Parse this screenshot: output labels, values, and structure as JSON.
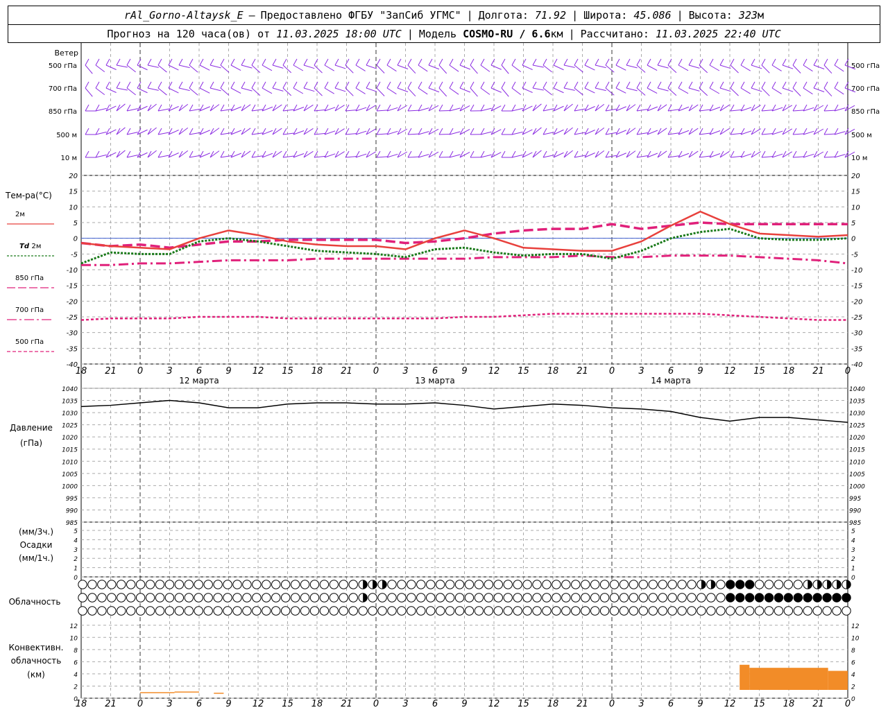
{
  "header": {
    "station": "rAl_Gorno-Altaysk_E",
    "dash": "–",
    "provider": "Предоставлено ФГБУ \"ЗапСиб УГМС\"",
    "lon_label": "Долгота:",
    "lon": "71.92",
    "lat_label": "Широта:",
    "lat": "45.086",
    "alt_label": "Высота:",
    "alt": "323",
    "alt_unit": "м",
    "forecast_prefix": "Прогноз на 120 часа(ов) от",
    "forecast_start": "11.03.2025 18:00 UTC",
    "model_label": "Модель",
    "model": "COSMO-RU / 6.6",
    "model_unit": "км",
    "calc_label": "Рассчитано:",
    "calc_time": "11.03.2025 22:40 UTC"
  },
  "time_axis": {
    "ticks": [
      "18",
      "21",
      "0",
      "3",
      "6",
      "9",
      "12",
      "15",
      "18",
      "21",
      "0",
      "3",
      "6",
      "9",
      "12",
      "15",
      "18",
      "21",
      "0",
      "3",
      "6",
      "9",
      "12",
      "15",
      "18",
      "21",
      "0"
    ],
    "day_labels": [
      "12 марта",
      "13 марта",
      "14 марта"
    ]
  },
  "wind_panel": {
    "title": "Ветер",
    "levels": [
      "500 гПа",
      "700 гПа",
      "850 гПа",
      "500 м",
      "10 м"
    ],
    "colors": {
      "barb": "#8a2be2"
    }
  },
  "temp_panel": {
    "title": "Тем-ра(°C)",
    "yticks": [
      "20",
      "15",
      "10",
      "5",
      "0",
      "-5",
      "-10",
      "-15",
      "-20",
      "-25",
      "-30",
      "-35",
      "-40"
    ],
    "legend": [
      {
        "prefix": "",
        "label": "2м",
        "color": "#e8403c",
        "style": "solid"
      },
      {
        "prefix": "Td",
        "label": "2м",
        "color": "#1a7a1a",
        "style": "dotted"
      },
      {
        "prefix": "",
        "label": "850 гПа",
        "color": "#e0207a",
        "style": "dash"
      },
      {
        "prefix": "",
        "label": "700 гПа",
        "color": "#e0207a",
        "style": "dashdot"
      },
      {
        "prefix": "",
        "label": "500 гПа",
        "color": "#e0207a",
        "style": "shortdash"
      }
    ]
  },
  "pressure_panel": {
    "title": "Давление",
    "unit": "(гПа)",
    "yticks": [
      "1040",
      "1035",
      "1030",
      "1025",
      "1020",
      "1015",
      "1010",
      "1005",
      "1000",
      "995",
      "990",
      "985"
    ]
  },
  "precip_panel": {
    "unit_top": "(мм/3ч.)",
    "title": "Осадки",
    "unit_bottom": "(мм/1ч.)",
    "yticks": [
      "5",
      "4",
      "3",
      "2",
      "1",
      "0"
    ]
  },
  "cloud_panel": {
    "title": "Облачность"
  },
  "conv_panel": {
    "title1": "Конвективн.",
    "title2": "облачность",
    "unit": "(км)",
    "yticks": [
      "12",
      "10",
      "8",
      "6",
      "4",
      "2",
      "0"
    ],
    "color": "#f28c28"
  },
  "chart_data": {
    "type": "line",
    "x_hours": [
      0,
      3,
      6,
      9,
      12,
      15,
      18,
      21,
      24,
      27,
      30,
      33,
      36,
      39,
      42,
      45,
      48,
      51,
      54,
      57,
      60,
      63,
      66,
      69,
      72,
      75,
      78
    ],
    "t2m": [
      -1.5,
      -2.5,
      -3,
      -3.5,
      0,
      2.5,
      1,
      -1,
      -2,
      -2.5,
      -2.5,
      -3.5,
      0,
      2.5,
      0,
      -3,
      -3.5,
      -4,
      -4,
      -1,
      4,
      8.5,
      4.5,
      1.5,
      1,
      0.5,
      1
    ],
    "td2m": [
      -8,
      -4.5,
      -5,
      -5,
      -1,
      0,
      -1,
      -2.5,
      -4,
      -4.5,
      -5,
      -6,
      -3.5,
      -3,
      -4.5,
      -5.5,
      -5,
      -5,
      -6.5,
      -4,
      0,
      2,
      3,
      0,
      -0.5,
      -0.5,
      0
    ],
    "t850": [
      -1.5,
      -2.5,
      -2,
      -3,
      -2,
      -1,
      -1,
      -0.5,
      -0.5,
      -0.5,
      -0.5,
      -1.5,
      -1,
      0,
      1.5,
      2.5,
      3,
      3,
      4.5,
      3,
      4,
      5,
      4.5,
      4.5,
      4.5,
      4.5,
      4.5
    ],
    "t700": [
      -8.5,
      -8.5,
      -8,
      -8,
      -7.5,
      -7,
      -7,
      -7,
      -6.5,
      -6.5,
      -6.5,
      -6.5,
      -6.5,
      -6.5,
      -6,
      -6,
      -6,
      -5.5,
      -6,
      -6,
      -5.5,
      -5.5,
      -5.5,
      -6,
      -6.5,
      -7,
      -8
    ],
    "t500": [
      -26,
      -25.5,
      -25.5,
      -25.5,
      -25,
      -25,
      -25,
      -25.5,
      -25.5,
      -25.5,
      -25.5,
      -25.5,
      -25.5,
      -25,
      -25,
      -24.5,
      -24,
      -24,
      -24,
      -24,
      -24,
      -24,
      -24.5,
      -25,
      -25.5,
      -26,
      -26
    ],
    "pressure": [
      1032.5,
      1033,
      1034,
      1035,
      1034,
      1032,
      1032,
      1033.5,
      1034,
      1034,
      1033.5,
      1033.5,
      1034,
      1033,
      1031.5,
      1032.5,
      1033.5,
      1033,
      1032,
      1031.5,
      1030.5,
      1028,
      1026.5,
      1028,
      1028,
      1027,
      1026
    ],
    "conv_top_km": [
      [
        6,
        9.5,
        1
      ],
      [
        9.5,
        12,
        1.1
      ],
      [
        13.5,
        14.5,
        0.9
      ],
      [
        67,
        68,
        5.5
      ],
      [
        68,
        76,
        5
      ],
      [
        76,
        79,
        4.5
      ]
    ],
    "ylim_temp": [
      -40,
      20
    ],
    "ylim_pressure": [
      985,
      1040
    ],
    "ylim_precip": [
      0,
      5
    ],
    "ylim_conv": [
      0,
      13
    ]
  }
}
